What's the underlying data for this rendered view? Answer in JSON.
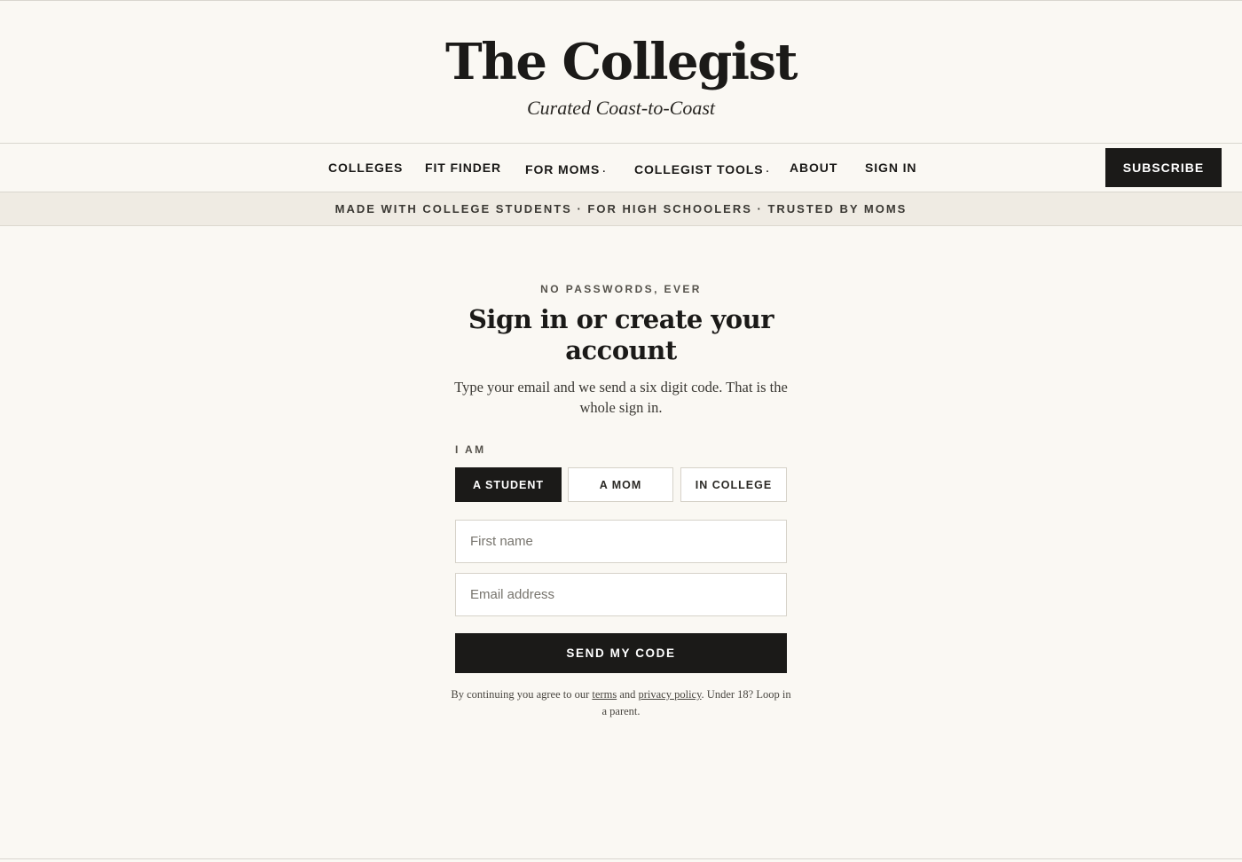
{
  "masthead": {
    "title": "The Collegist",
    "tagline": "Curated Coast-to-Coast"
  },
  "nav": {
    "items": [
      {
        "label": "COLLEGES",
        "has_dropdown": false
      },
      {
        "label": "FIT FINDER",
        "has_dropdown": false
      },
      {
        "label": "FOR MOMS",
        "has_dropdown": true,
        "dropdown_marker": "·"
      },
      {
        "label": "COLLEGIST TOOLS",
        "has_dropdown": true,
        "dropdown_marker": "·"
      },
      {
        "label": "ABOUT",
        "has_dropdown": false
      },
      {
        "label": "SIGN IN",
        "has_dropdown": false
      }
    ],
    "subscribe_label": "SUBSCRIBE"
  },
  "banner": {
    "text": "MADE WITH COLLEGE STUDENTS · FOR HIGH SCHOOLERS · TRUSTED BY MOMS"
  },
  "form": {
    "eyebrow": "NO PASSWORDS, EVER",
    "heading": "Sign in or create your account",
    "lede": "Type your email and we send a six digit code. That is the whole sign in.",
    "role_label": "I AM",
    "roles": [
      {
        "label": "A STUDENT",
        "selected": true
      },
      {
        "label": "A MOM",
        "selected": false
      },
      {
        "label": "IN COLLEGE",
        "selected": false
      }
    ],
    "first_name": {
      "value": "",
      "placeholder": "First name"
    },
    "email": {
      "value": "",
      "placeholder": "Email address"
    },
    "submit_label": "SEND MY CODE",
    "legal": {
      "prefix": "By continuing you agree to our",
      "terms_link": "terms",
      "middle": "and",
      "privacy_link": "privacy policy",
      "suffix": ". Under 18? Loop in a parent."
    }
  },
  "colors": {
    "background": "#faf8f3",
    "ink": "#1b1a18",
    "banner_background": "#efebe3",
    "border": "#d6d2c9"
  }
}
